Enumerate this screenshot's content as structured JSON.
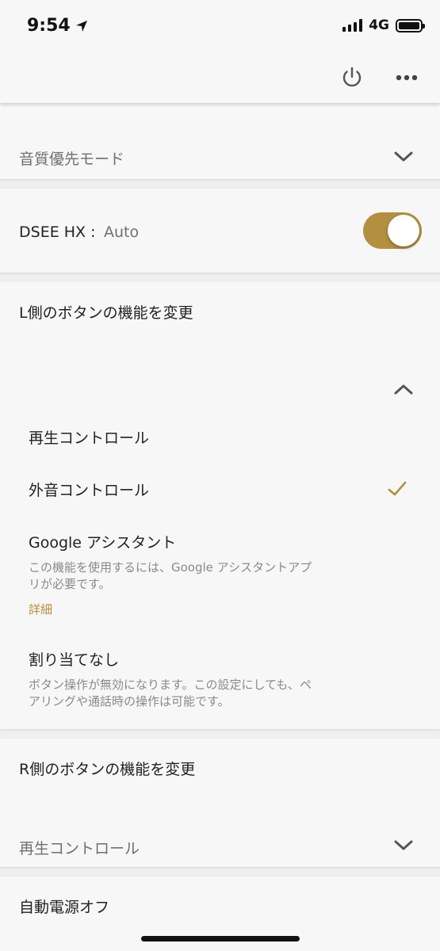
{
  "status_bar": {
    "time": "9:54",
    "network": "4G"
  },
  "colors": {
    "accent": "#b38f3f",
    "background": "#efefef",
    "card": "#f7f7f7"
  },
  "header": {
    "power_icon": "power-icon",
    "more_icon": "more-horizontal-icon"
  },
  "sound_mode": {
    "value": "音質優先モード"
  },
  "dsee": {
    "label": "DSEE HX :",
    "value": "Auto",
    "toggle_on": true
  },
  "left_button": {
    "title": "L側のボタンの機能を変更",
    "options": [
      {
        "label": "再生コントロール",
        "selected": false
      },
      {
        "label": "外音コントロール",
        "selected": true
      },
      {
        "label": "Google アシスタント",
        "desc_line1": "この機能を使用するには、Google アシスタントアプ",
        "desc_line2": "リが必要です。",
        "link": "詳細",
        "selected": false
      },
      {
        "label": "割り当てなし",
        "desc_line1": "ボタン操作が無効になります。この設定にしても、ペ",
        "desc_line2": "アリングや通話時の操作は可能です。",
        "selected": false
      }
    ]
  },
  "right_button": {
    "title": "R側のボタンの機能を変更",
    "value": "再生コントロール"
  },
  "auto_power_off": {
    "title": "自動電源オフ"
  }
}
